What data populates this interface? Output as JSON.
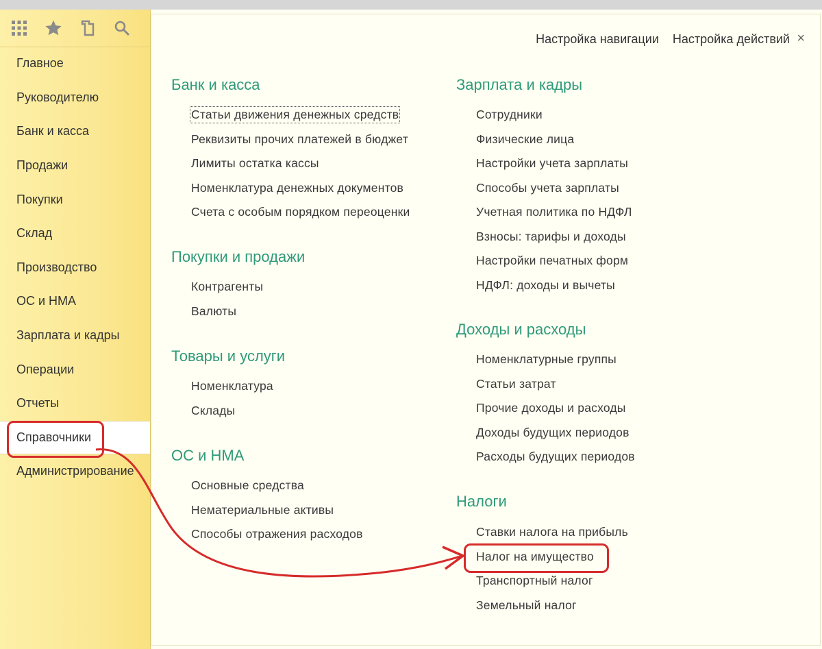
{
  "toolbar": {
    "icons": [
      "apps-grid-icon",
      "star-icon",
      "history-icon",
      "search-icon"
    ]
  },
  "sidebar": {
    "items": [
      {
        "label": "Главное"
      },
      {
        "label": "Руководителю"
      },
      {
        "label": "Банк и касса"
      },
      {
        "label": "Продажи"
      },
      {
        "label": "Покупки"
      },
      {
        "label": "Склад"
      },
      {
        "label": "Производство"
      },
      {
        "label": "ОС и НМА"
      },
      {
        "label": "Зарплата и кадры"
      },
      {
        "label": "Операции"
      },
      {
        "label": "Отчеты"
      },
      {
        "label": "Справочники"
      },
      {
        "label": "Администрирование"
      }
    ],
    "active_index": 11
  },
  "header": {
    "nav_settings": "Настройка навигации",
    "actions_settings": "Настройка действий",
    "close": "×"
  },
  "left_sections": [
    {
      "title": "Банк и касса",
      "links": [
        "Статьи движения денежных средств",
        "Реквизиты прочих платежей в бюджет",
        "Лимиты остатка кассы",
        "Номенклатура денежных документов",
        "Счета с особым порядком переоценки"
      ]
    },
    {
      "title": "Покупки и продажи",
      "links": [
        "Контрагенты",
        "Валюты"
      ]
    },
    {
      "title": "Товары и услуги",
      "links": [
        "Номенклатура",
        "Склады"
      ]
    },
    {
      "title": "ОС и НМА",
      "links": [
        "Основные средства",
        "Нематериальные активы",
        "Способы отражения расходов"
      ]
    }
  ],
  "right_sections": [
    {
      "title": "Зарплата и кадры",
      "links": [
        "Сотрудники",
        "Физические лица",
        "Настройки учета зарплаты",
        "Способы учета зарплаты",
        "Учетная политика по НДФЛ",
        "Взносы: тарифы и доходы",
        "Настройки печатных форм",
        "НДФЛ: доходы и вычеты"
      ]
    },
    {
      "title": "Доходы и расходы",
      "links": [
        "Номенклатурные группы",
        "Статьи затрат",
        "Прочие доходы и расходы",
        "Доходы будущих периодов",
        "Расходы будущих периодов"
      ]
    },
    {
      "title": "Налоги",
      "links": [
        "Ставки налога на прибыль",
        "Налог на имущество",
        "Транспортный налог",
        "Земельный налог"
      ]
    }
  ],
  "colors": {
    "section_title": "#2f9a7a",
    "sidebar_bg": "#fbe792",
    "annotation": "#d62b2b"
  }
}
